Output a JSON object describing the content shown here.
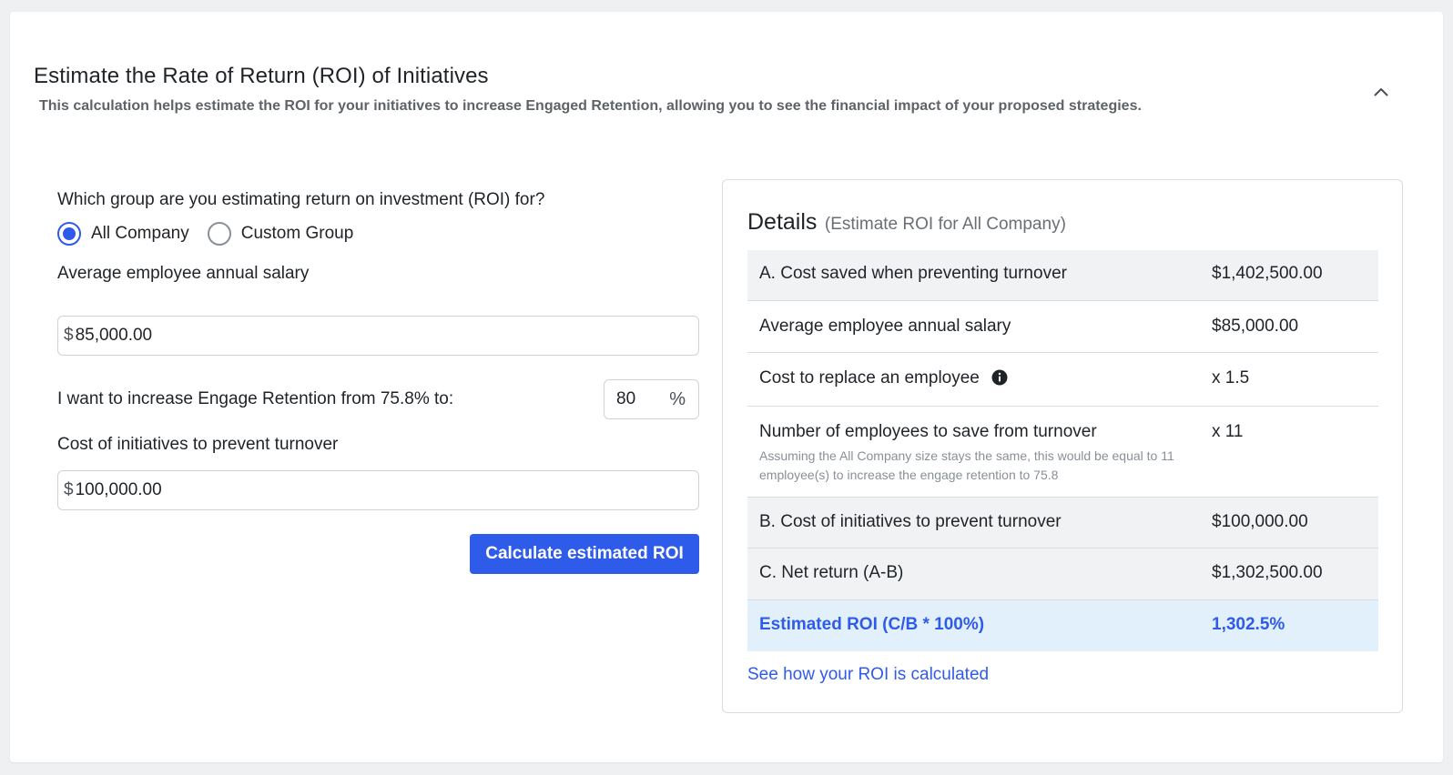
{
  "header": {
    "title": "Estimate the Rate of Return (ROI) of Initiatives",
    "subtitle": "This calculation helps estimate the ROI for your initiatives to increase Engaged Retention, allowing you to see the financial impact of your proposed strategies.",
    "collapse_icon": "chevron-up-icon"
  },
  "form": {
    "group_question": "Which group are you estimating return on investment (ROI) for?",
    "group_options": [
      {
        "label": "All Company",
        "selected": true
      },
      {
        "label": "Custom Group",
        "selected": false
      }
    ],
    "salary_label": "Average employee annual salary",
    "currency_symbol": "$",
    "salary_value": "85,000.00",
    "retention_label": "I want to increase Engage Retention from 75.8% to:",
    "retention_value": "80",
    "percent_symbol": "%",
    "cost_label": "Cost of initiatives to prevent turnover",
    "cost_value": "100,000.00",
    "calculate_button": "Calculate estimated ROI"
  },
  "details": {
    "title": "Details",
    "subtitle": "(Estimate ROI for All Company)",
    "rows": [
      {
        "label": "A. Cost saved when preventing turnover",
        "value": "$1,402,500.00"
      },
      {
        "label": "Average employee annual salary",
        "value": "$85,000.00"
      },
      {
        "label": "Cost to replace an employee",
        "value": "x 1.5"
      },
      {
        "label": "Number of employees to save from turnover",
        "value": "x 11",
        "note": "Assuming the All Company size stays the same, this would be equal to 11 employee(s) to increase the engage retention to 75.8"
      },
      {
        "label": "B. Cost of initiatives to prevent turnover",
        "value": "$100,000.00"
      },
      {
        "label": "C. Net return (A-B)",
        "value": "$1,302,500.00"
      },
      {
        "label": "Estimated ROI (C/B * 100%)",
        "value": "1,302.5%"
      }
    ],
    "info_icon": "info-icon",
    "link_text": "See how your ROI is calculated"
  },
  "colors": {
    "accent": "#2f5bea",
    "highlight_row": "#e2f0fb",
    "shaded_row": "#f1f2f3"
  }
}
